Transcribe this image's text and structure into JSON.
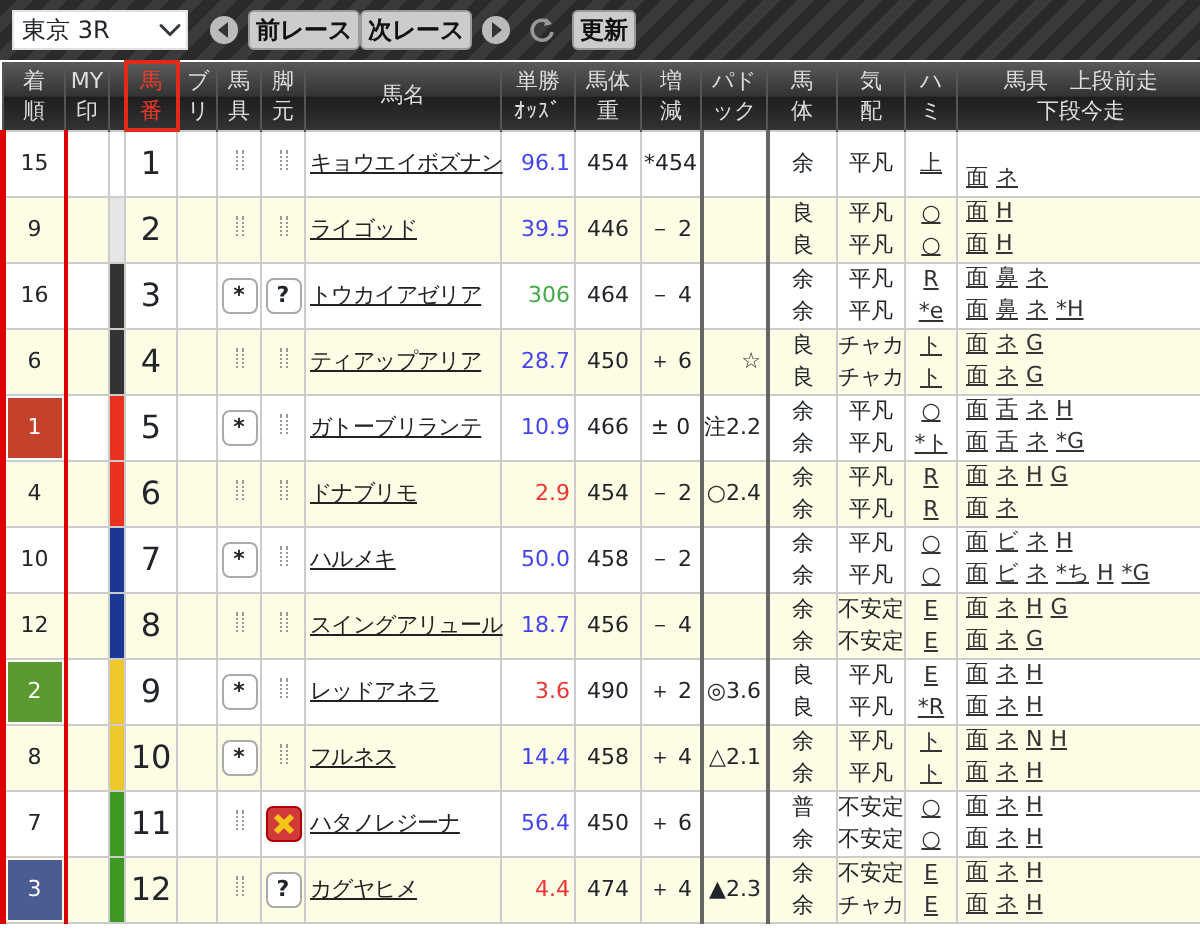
{
  "toolbar": {
    "race": "東京 3R",
    "prev_button": "前レース",
    "next_button": "次レース",
    "update_button": "更新"
  },
  "columns": [
    {
      "lines": [
        "着",
        "順"
      ],
      "sorted": false
    },
    {
      "lines": [
        "MY",
        "印"
      ],
      "sorted": false
    },
    {
      "kind": "spacer"
    },
    {
      "lines": [
        "馬",
        "番"
      ],
      "sorted": true
    },
    {
      "lines": [
        "ブ",
        "リ"
      ],
      "sorted": false
    },
    {
      "lines": [
        "馬",
        "具"
      ],
      "sorted": false
    },
    {
      "lines": [
        "脚",
        "元"
      ],
      "sorted": false
    },
    {
      "lines": [
        "馬名"
      ],
      "sorted": false
    },
    {
      "lines": [
        "単勝",
        "ｵｯｽﾞ"
      ],
      "sorted": false
    },
    {
      "lines": [
        "馬体",
        "重"
      ],
      "sorted": false
    },
    {
      "lines": [
        "増",
        "減"
      ],
      "sorted": false
    },
    {
      "lines": [
        "パド",
        "ック"
      ],
      "sorted": false
    },
    {
      "lines": [
        "馬",
        "体"
      ],
      "sorted": false
    },
    {
      "lines": [
        "気",
        "配"
      ],
      "sorted": false
    },
    {
      "lines": [
        "ハ",
        "ミ"
      ],
      "sorted": false
    },
    {
      "lines": [
        "馬具　上段前走",
        "下段今走"
      ],
      "sorted": false
    }
  ],
  "rows": [
    {
      "finish": {
        "text": "15"
      },
      "frame": {
        "color": "#ffffff"
      },
      "number": "1",
      "name": "キョウエイボズナン",
      "odds": {
        "text": "96.1",
        "color": "#4444ee"
      },
      "weight": "454",
      "change": "*454",
      "current": {
        "body": "余",
        "mood": "平凡",
        "bit": "上",
        "gear": [
          "面",
          "ネ"
        ]
      }
    },
    {
      "finish": {
        "text": "9"
      },
      "frame": {
        "color": "#e6e6e6"
      },
      "number": "2",
      "name": "ライゴッド",
      "odds": {
        "text": "39.5",
        "color": "#4444ee"
      },
      "weight": "446",
      "change": "－ 2",
      "previous": {
        "body": "良",
        "mood": "平凡",
        "bit": "○",
        "gear": [
          "面",
          "H"
        ]
      },
      "current": {
        "body": "良",
        "mood": "平凡",
        "bit": "○",
        "gear": [
          "面",
          "H"
        ]
      }
    },
    {
      "finish": {
        "text": "16"
      },
      "frame": {
        "color": "#333333"
      },
      "number": "3",
      "gear": "*",
      "legs": {
        "kind": "question",
        "text": "?"
      },
      "name": "トウカイアゼリア",
      "odds": {
        "text": "306",
        "color": "#44aa44"
      },
      "weight": "464",
      "change": "－ 4",
      "previous": {
        "body": "余",
        "mood": "平凡",
        "bit": "R",
        "gear": [
          "面",
          "鼻",
          "ネ"
        ]
      },
      "current": {
        "body": "余",
        "mood": "平凡",
        "bit": "*e",
        "gear": [
          "面",
          "鼻",
          "ネ",
          "*H"
        ]
      }
    },
    {
      "finish": {
        "text": "6"
      },
      "frame": {
        "color": "#333333"
      },
      "number": "4",
      "name": "ティアップアリア",
      "odds": {
        "text": "28.7",
        "color": "#4444ee"
      },
      "weight": "450",
      "change": "＋ 6",
      "paddock": "☆",
      "previous": {
        "body": "良",
        "mood": "チャカ",
        "bit": "ト",
        "gear": [
          "面",
          "ネ",
          "G"
        ]
      },
      "current": {
        "body": "良",
        "mood": "チャカ",
        "bit": "ト",
        "gear": [
          "面",
          "ネ",
          "G"
        ]
      }
    },
    {
      "finish": {
        "text": "1",
        "color": "#c4412c"
      },
      "frame": {
        "color": "#e8321e"
      },
      "number": "5",
      "gear": "*",
      "name": "ガトーブリランテ",
      "odds": {
        "text": "10.9",
        "color": "#4444ee"
      },
      "weight": "466",
      "change": "± 0",
      "paddock": "注2.2",
      "previous": {
        "body": "余",
        "mood": "平凡",
        "bit": "○",
        "gear": [
          "面",
          "舌",
          "ネ",
          "H"
        ]
      },
      "current": {
        "body": "余",
        "mood": "平凡",
        "bit": "*ト",
        "gear": [
          "面",
          "舌",
          "ネ",
          "*G"
        ]
      }
    },
    {
      "finish": {
        "text": "4"
      },
      "frame": {
        "color": "#e8321e"
      },
      "number": "6",
      "name": "ドナブリモ",
      "odds": {
        "text": "2.9",
        "color": "#ee3333"
      },
      "weight": "454",
      "change": "－ 2",
      "paddock": "○2.4",
      "previous": {
        "body": "余",
        "mood": "平凡",
        "bit": "R",
        "gear": [
          "面",
          "ネ",
          "H",
          "G"
        ]
      },
      "current": {
        "body": "余",
        "mood": "平凡",
        "bit": "R",
        "gear": [
          "面",
          "ネ"
        ]
      }
    },
    {
      "finish": {
        "text": "10"
      },
      "frame": {
        "color": "#1a3796"
      },
      "number": "7",
      "gear": "*",
      "name": "ハルメキ",
      "odds": {
        "text": "50.0",
        "color": "#4444ee"
      },
      "weight": "458",
      "change": "－ 2",
      "previous": {
        "body": "余",
        "mood": "平凡",
        "bit": "○",
        "gear": [
          "面",
          "ビ",
          "ネ",
          "H"
        ]
      },
      "current": {
        "body": "余",
        "mood": "平凡",
        "bit": "○",
        "gear": [
          "面",
          "ビ",
          "ネ",
          "*ち",
          "H",
          "*G"
        ]
      }
    },
    {
      "finish": {
        "text": "12"
      },
      "frame": {
        "color": "#1a3796"
      },
      "number": "8",
      "name": "スイングアリュール",
      "odds": {
        "text": "18.7",
        "color": "#4444ee"
      },
      "weight": "456",
      "change": "－ 4",
      "previous": {
        "body": "余",
        "mood": "不安定",
        "bit": "E",
        "gear": [
          "面",
          "ネ",
          "H",
          "G"
        ]
      },
      "current": {
        "body": "余",
        "mood": "不安定",
        "bit": "E",
        "gear": [
          "面",
          "ネ",
          "G"
        ]
      }
    },
    {
      "finish": {
        "text": "2",
        "color": "#5a9a2e"
      },
      "frame": {
        "color": "#eec82a"
      },
      "number": "9",
      "gear": "*",
      "name": "レッドアネラ",
      "odds": {
        "text": "3.6",
        "color": "#ee3333"
      },
      "weight": "490",
      "change": "＋ 2",
      "paddock": "◎3.6",
      "previous": {
        "body": "良",
        "mood": "平凡",
        "bit": "E",
        "gear": [
          "面",
          "ネ",
          "H"
        ]
      },
      "current": {
        "body": "良",
        "mood": "平凡",
        "bit": "*R",
        "gear": [
          "面",
          "ネ",
          "H"
        ]
      }
    },
    {
      "finish": {
        "text": "8"
      },
      "frame": {
        "color": "#eec82a"
      },
      "number": "10",
      "gear": "*",
      "name": "フルネス",
      "odds": {
        "text": "14.4",
        "color": "#4444ee"
      },
      "weight": "458",
      "change": "＋ 4",
      "paddock": "△2.1",
      "previous": {
        "body": "余",
        "mood": "平凡",
        "bit": "ト",
        "gear": [
          "面",
          "ネ",
          "N",
          "H"
        ]
      },
      "current": {
        "body": "余",
        "mood": "平凡",
        "bit": "ト",
        "gear": [
          "面",
          "ネ",
          "H"
        ]
      }
    },
    {
      "finish": {
        "text": "7"
      },
      "frame": {
        "color": "#3c9a22"
      },
      "number": "11",
      "legs": {
        "kind": "warning"
      },
      "name": "ハタノレジーナ",
      "odds": {
        "text": "56.4",
        "color": "#4444ee"
      },
      "weight": "450",
      "change": "＋ 6",
      "previous": {
        "body": "普",
        "mood": "不安定",
        "bit": "○",
        "gear": [
          "面",
          "ネ",
          "H"
        ]
      },
      "current": {
        "body": "余",
        "mood": "不安定",
        "bit": "○",
        "gear": [
          "面",
          "ネ",
          "H"
        ]
      }
    },
    {
      "finish": {
        "text": "3",
        "color": "#4a5c92"
      },
      "frame": {
        "color": "#3c9a22"
      },
      "number": "12",
      "legs": {
        "kind": "question",
        "text": "?"
      },
      "name": "カグヤヒメ",
      "odds": {
        "text": "4.4",
        "color": "#ee3333"
      },
      "weight": "474",
      "change": "＋ 4",
      "paddock": "▲2.3",
      "previous": {
        "body": "余",
        "mood": "不安定",
        "bit": "E",
        "gear": [
          "面",
          "ネ",
          "H"
        ]
      },
      "current": {
        "body": "余",
        "mood": "チャカ",
        "bit": "E",
        "gear": [
          "面",
          "ネ",
          "H"
        ]
      }
    }
  ]
}
